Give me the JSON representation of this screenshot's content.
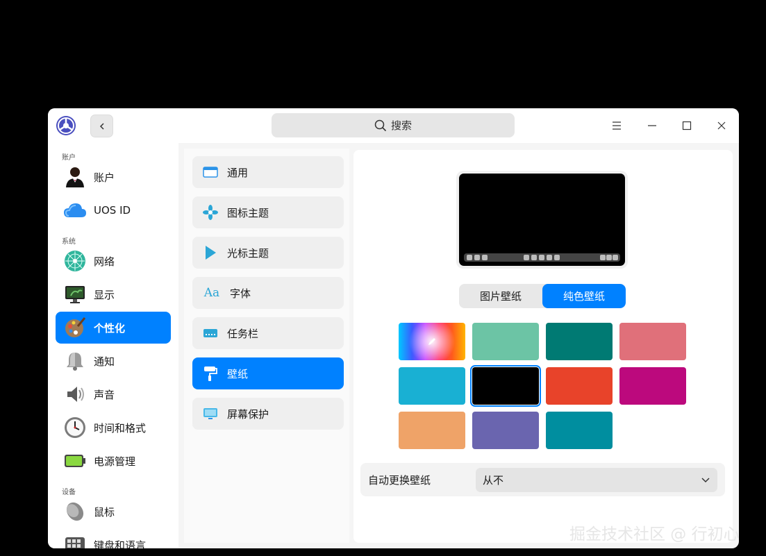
{
  "titlebar": {
    "search_placeholder": "搜索",
    "icons": {
      "logo": "control-center-logo",
      "back": "chevron-left-icon",
      "search": "search-icon",
      "menu": "hamburger-menu-icon",
      "minimize": "minimize-icon",
      "maximize": "maximize-icon",
      "close": "close-icon"
    }
  },
  "sidebar": {
    "groups": [
      {
        "label": "账户"
      },
      {
        "label": "系统"
      },
      {
        "label": "设备"
      }
    ],
    "items": [
      {
        "label": "账户",
        "icon": "user-icon"
      },
      {
        "label": "UOS ID",
        "icon": "cloud-icon"
      },
      {
        "label": "网络",
        "icon": "network-icon"
      },
      {
        "label": "显示",
        "icon": "display-icon"
      },
      {
        "label": "个性化",
        "icon": "personalization-icon",
        "active": true
      },
      {
        "label": "通知",
        "icon": "bell-icon"
      },
      {
        "label": "声音",
        "icon": "speaker-icon"
      },
      {
        "label": "时间和格式",
        "icon": "clock-icon"
      },
      {
        "label": "电源管理",
        "icon": "battery-icon"
      },
      {
        "label": "鼠标",
        "icon": "mouse-icon"
      },
      {
        "label": "键盘和语言",
        "icon": "keyboard-icon"
      }
    ]
  },
  "submenu": {
    "items": [
      {
        "label": "通用",
        "icon": "window-icon"
      },
      {
        "label": "图标主题",
        "icon": "icon-theme-icon"
      },
      {
        "label": "光标主题",
        "icon": "cursor-icon"
      },
      {
        "label": "字体",
        "icon": "font-icon"
      },
      {
        "label": "任务栏",
        "icon": "taskbar-icon"
      },
      {
        "label": "壁纸",
        "icon": "paint-roller-icon",
        "active": true
      },
      {
        "label": "屏幕保护",
        "icon": "screensaver-icon"
      }
    ]
  },
  "wallpaper": {
    "tabs": [
      {
        "label": "图片壁纸",
        "active": false
      },
      {
        "label": "纯色壁纸",
        "active": true
      }
    ],
    "colors": [
      "custom",
      "#6cc4a5",
      "#007a73",
      "#e0707a",
      "#19b0d3",
      "#000000",
      "#e8432a",
      "#bc097d",
      "#efa368",
      "#6a65af",
      "#008e9f"
    ],
    "selected_color": "#000000",
    "auto_change": {
      "label": "自动更换壁纸",
      "value": "从不"
    }
  },
  "watermark": "掘金技术社区 @ 行初心"
}
